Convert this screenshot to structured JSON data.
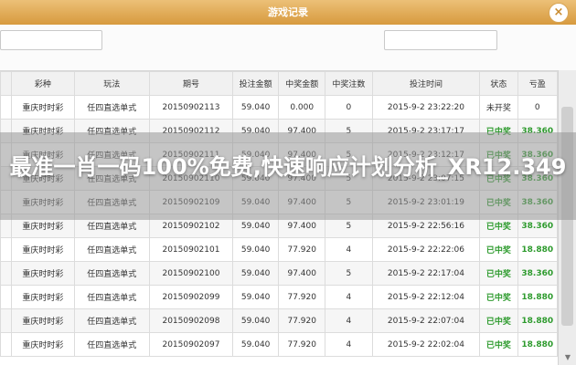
{
  "window": {
    "title": "游戏记录",
    "close_label": "×"
  },
  "table": {
    "columns": [
      "彩种",
      "玩法",
      "期号",
      "投注金额",
      "中奖金额",
      "中奖注数",
      "投注时间",
      "状态",
      "亏盈"
    ],
    "rows": [
      [
        "重庆时时彩",
        "任四直选单式",
        "20150902113",
        "59.040",
        "0.000",
        "0",
        "2015-9-2 23:22:20",
        "未开奖",
        "0"
      ],
      [
        "重庆时时彩",
        "任四直选单式",
        "20150902112",
        "59.040",
        "97.400",
        "5",
        "2015-9-2 23:17:17",
        "已中奖",
        "38.360"
      ],
      [
        "重庆时时彩",
        "任四直选单式",
        "20150902111",
        "59.040",
        "97.400",
        "5",
        "2015-9-2 23:12:17",
        "已中奖",
        "38.360"
      ],
      [
        "重庆时时彩",
        "任四直选单式",
        "20150902110",
        "59.040",
        "97.400",
        "5",
        "2015-9-2 23:07:15",
        "已中奖",
        "38.360"
      ],
      [
        "重庆时时彩",
        "任四直选单式",
        "20150902109",
        "59.040",
        "97.400",
        "5",
        "2015-9-2 23:01:19",
        "已中奖",
        "38.360"
      ],
      [
        "重庆时时彩",
        "任四直选单式",
        "20150902102",
        "59.040",
        "97.400",
        "5",
        "2015-9-2 22:56:16",
        "已中奖",
        "38.360"
      ],
      [
        "重庆时时彩",
        "任四直选单式",
        "20150902101",
        "59.040",
        "77.920",
        "4",
        "2015-9-2 22:22:06",
        "已中奖",
        "18.880"
      ],
      [
        "重庆时时彩",
        "任四直选单式",
        "20150902100",
        "59.040",
        "97.400",
        "5",
        "2015-9-2 22:17:04",
        "已中奖",
        "38.360"
      ],
      [
        "重庆时时彩",
        "任四直选单式",
        "20150902099",
        "59.040",
        "77.920",
        "4",
        "2015-9-2 22:12:04",
        "已中奖",
        "18.880"
      ],
      [
        "重庆时时彩",
        "任四直选单式",
        "20150902098",
        "59.040",
        "77.920",
        "4",
        "2015-9-2 22:07:04",
        "已中奖",
        "18.880"
      ],
      [
        "重庆时时彩",
        "任四直选单式",
        "20150902097",
        "59.040",
        "77.920",
        "4",
        "2015-9-2 22:02:04",
        "已中奖",
        "18.880"
      ]
    ]
  },
  "banner": {
    "text": "最准一肖一码100%免费,快速响应计划分析_XR12.349"
  },
  "colors": {
    "title_bar": "#d9a04a",
    "win_status": "#2e9b2e",
    "banner": "#8f8f8f"
  }
}
